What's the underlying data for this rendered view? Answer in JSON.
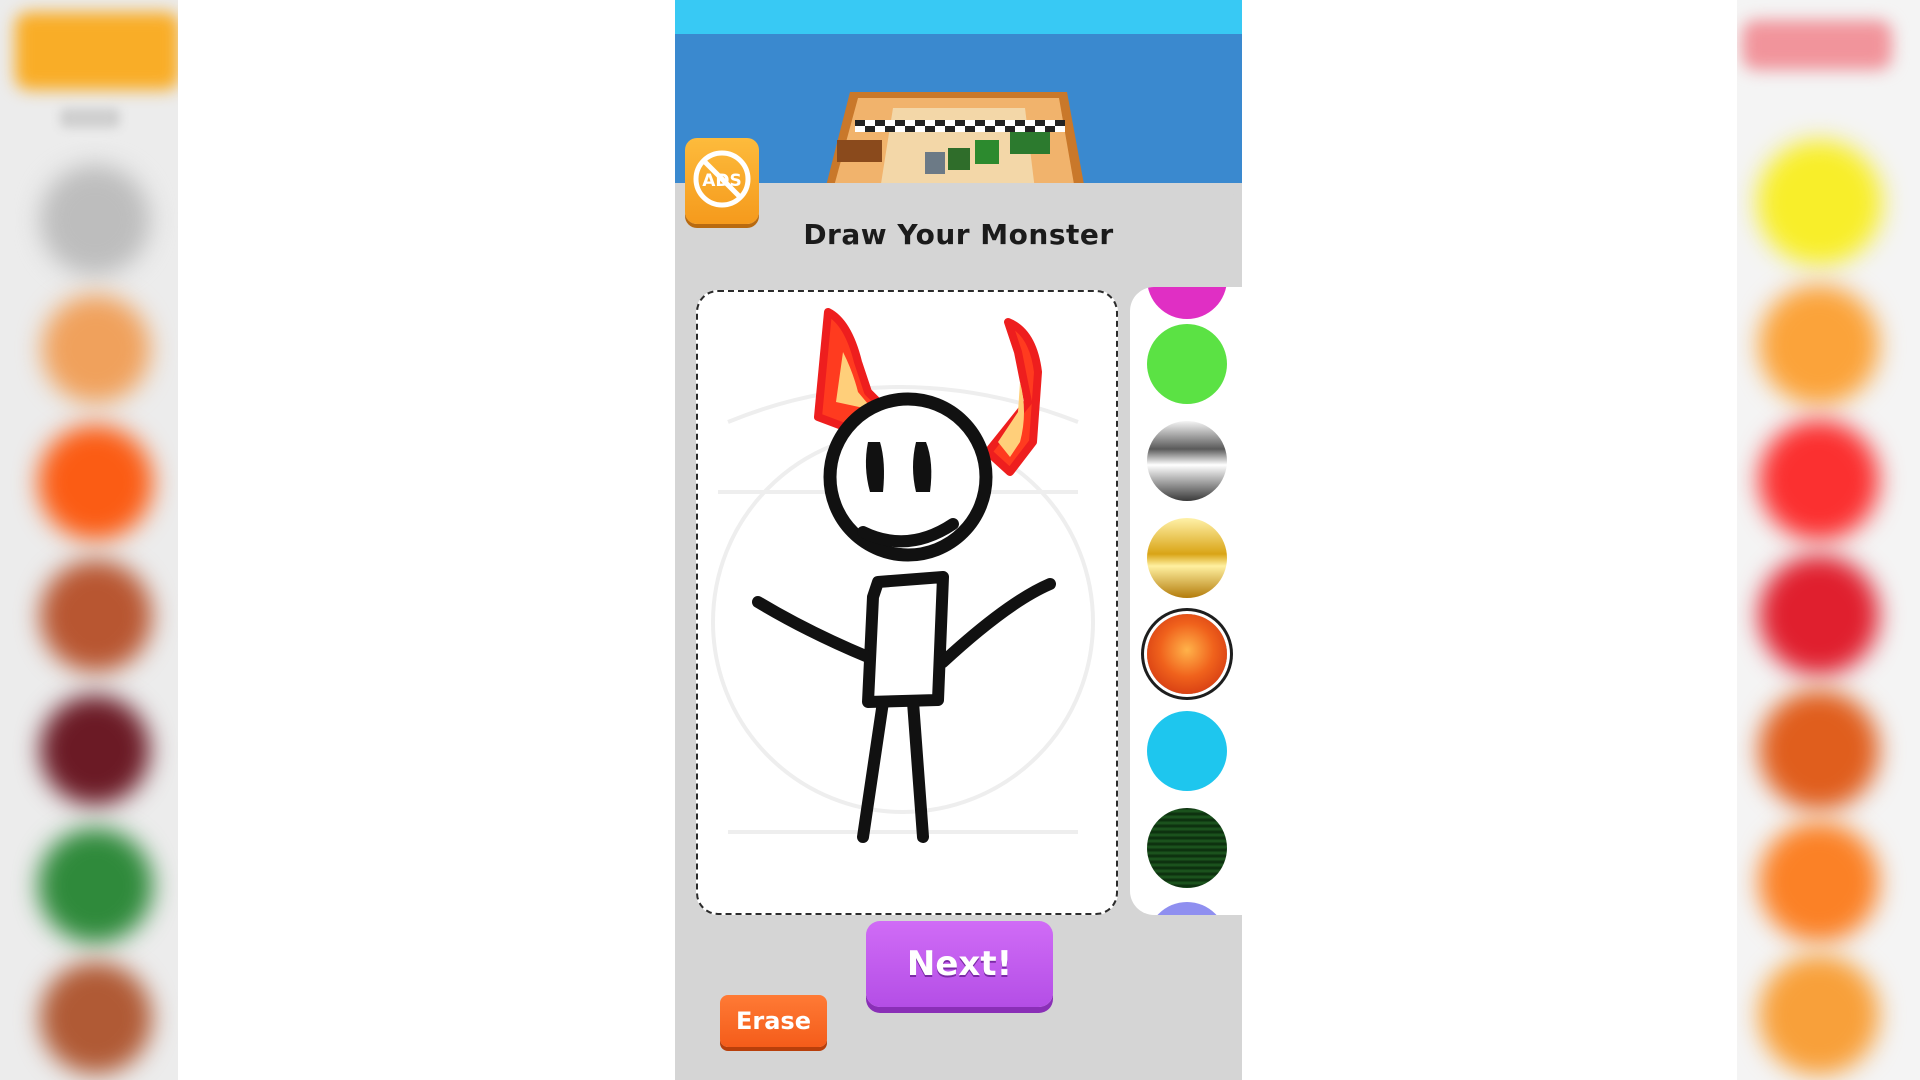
{
  "screen": {
    "title": "Draw Your Monster",
    "next_label": "Next!",
    "erase_label": "Erase",
    "no_ads_label": "ADS",
    "no_ads_icon": "no-ads-icon"
  },
  "palette": {
    "swatches": [
      {
        "name": "swatch-magenta",
        "color": "#e02fc4"
      },
      {
        "name": "swatch-green",
        "color": "#5be244"
      },
      {
        "name": "swatch-chrome",
        "color": "#8a8a8a"
      },
      {
        "name": "swatch-gold",
        "color": "#e2b52a"
      },
      {
        "name": "swatch-lava",
        "color": "#e8531c",
        "selected": true
      },
      {
        "name": "swatch-cyan",
        "color": "#1ec6ee"
      },
      {
        "name": "swatch-dark-green",
        "color": "#0f3d12"
      },
      {
        "name": "swatch-lavender",
        "color": "#8f8ff0"
      }
    ]
  },
  "side_strips": {
    "left_colors": [
      "#f9ad27",
      "#bdbdbd",
      "#f0a15c",
      "#fb5c14",
      "#b85631",
      "#6b1a25",
      "#2f8a3b",
      "#b05a35"
    ],
    "right_colors": [
      "#f1949b",
      "#f8ee2a",
      "#fba33a",
      "#fb3030",
      "#e01f2e",
      "#e05e1d",
      "#fb8126",
      "#f8a03a"
    ]
  }
}
